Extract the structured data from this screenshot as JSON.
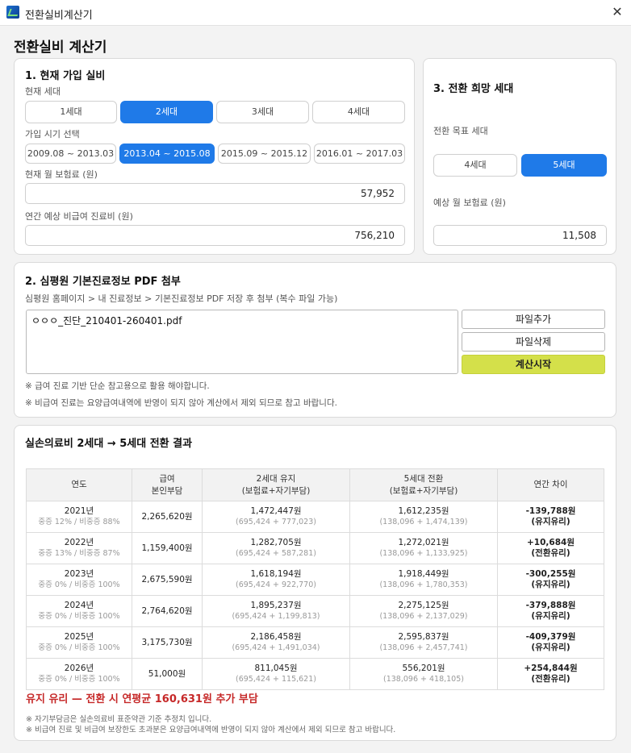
{
  "window": {
    "title": "전환실비계산기",
    "close": "✕"
  },
  "page_title": "전환실비 계산기",
  "current": {
    "heading": "1. 현재 가입 실비",
    "generation_label": "현재 세대",
    "generations": [
      "1세대",
      "2세대",
      "3세대",
      "4세대"
    ],
    "selected_generation": "2세대",
    "period_label": "가입 시기 선택",
    "periods": [
      "2009.08 ~ 2013.03",
      "2013.04 ~ 2015.08",
      "2015.09 ~ 2015.12",
      "2016.01 ~ 2017.03"
    ],
    "selected_period": "2013.04 ~ 2015.08",
    "premium_label": "현재 월 보험료 (원)",
    "premium_value": "57,952",
    "medical_label": "연간 예상 비급여 진료비 (원)",
    "medical_value": "756,210"
  },
  "target": {
    "heading": "3. 전환 희망 세대",
    "generation_label": "전환 목표 세대",
    "generations": [
      "4세대",
      "5세대"
    ],
    "selected_generation": "5세대",
    "premium_label": "예상 월 보험료 (원)",
    "premium_value": "11,508"
  },
  "attach": {
    "heading": "2. 심평원 기본진료정보 PDF 첨부",
    "path_hint": "심평원 홈페이지 > 내 진료정보 > 기본진료정보 PDF 저장 후 첨부  (복수 파일 가능)",
    "file_name": "ㅇㅇㅇ_진단_210401-260401.pdf",
    "add_button": "파일추가",
    "delete_button": "파일삭제",
    "start_button": "계산시작",
    "note1": "※ 급여 진료 기반 단순 참고용으로 활용 해야합니다.",
    "note2": "※ 비급여 진료는 요양급여내역에 반영이 되지 않아 계산에서 제외 되므로 참고 바랍니다."
  },
  "result": {
    "heading": "실손의료비 2세대 → 5세대 전환 결과",
    "headers": {
      "year": "연도",
      "copay": [
        "급여",
        "본인부담"
      ],
      "keep": [
        "2세대 유지",
        "(보험료+자기부담)"
      ],
      "switch": [
        "5세대 전환",
        "(보험료+자기부담)"
      ],
      "diff": "연간 차이"
    },
    "rows": [
      {
        "year": "2021년",
        "ratio": "중증 12% / 비중증 88%",
        "copay": "2,265,620원",
        "keep": "1,472,447원",
        "keep_detail": "(695,424 + 777,023)",
        "switch": "1,612,235원",
        "switch_detail": "(138,096 + 1,474,139)",
        "diff": "-139,788원",
        "verdict": "(유지유리)",
        "tone": "neg"
      },
      {
        "year": "2022년",
        "ratio": "중증 13% / 비중증 87%",
        "copay": "1,159,400원",
        "keep": "1,282,705원",
        "keep_detail": "(695,424 + 587,281)",
        "switch": "1,272,021원",
        "switch_detail": "(138,096 + 1,133,925)",
        "diff": "+10,684원",
        "verdict": "(전환유리)",
        "tone": "pos"
      },
      {
        "year": "2023년",
        "ratio": "중증 0% / 비중증 100%",
        "copay": "2,675,590원",
        "keep": "1,618,194원",
        "keep_detail": "(695,424 + 922,770)",
        "switch": "1,918,449원",
        "switch_detail": "(138,096 + 1,780,353)",
        "diff": "-300,255원",
        "verdict": "(유지유리)",
        "tone": "neg"
      },
      {
        "year": "2024년",
        "ratio": "중증 0% / 비중증 100%",
        "copay": "2,764,620원",
        "keep": "1,895,237원",
        "keep_detail": "(695,424 + 1,199,813)",
        "switch": "2,275,125원",
        "switch_detail": "(138,096 + 2,137,029)",
        "diff": "-379,888원",
        "verdict": "(유지유리)",
        "tone": "neg"
      },
      {
        "year": "2025년",
        "ratio": "중증 0% / 비중증 100%",
        "copay": "3,175,730원",
        "keep": "2,186,458원",
        "keep_detail": "(695,424 + 1,491,034)",
        "switch": "2,595,837원",
        "switch_detail": "(138,096 + 2,457,741)",
        "diff": "-409,379원",
        "verdict": "(유지유리)",
        "tone": "neg"
      },
      {
        "year": "2026년",
        "ratio": "중증 0% / 비중증 100%",
        "copay": "51,000원",
        "keep": "811,045원",
        "keep_detail": "(695,424 + 115,621)",
        "switch": "556,201원",
        "switch_detail": "(138,096 + 418,105)",
        "diff": "+254,844원",
        "verdict": "(전환유리)",
        "tone": "pos"
      }
    ],
    "summary": "유지 유리 — 전환 시 연평균 160,631원 추가 부담",
    "footnote1": "※ 자기부담금은 실손의료비 표준약관 기준 추정치 입니다.",
    "footnote2": "※ 비급여 진료 및 비급여 보장한도 초과분은 요양급여내역에 반영이 되지 않아 계산에서 제외 되므로 참고 바랍니다."
  },
  "colors": {
    "accent": "#1f7ae8",
    "start_button": "#d4e04a",
    "negative": "#c62828",
    "positive": "#2e7d32"
  }
}
